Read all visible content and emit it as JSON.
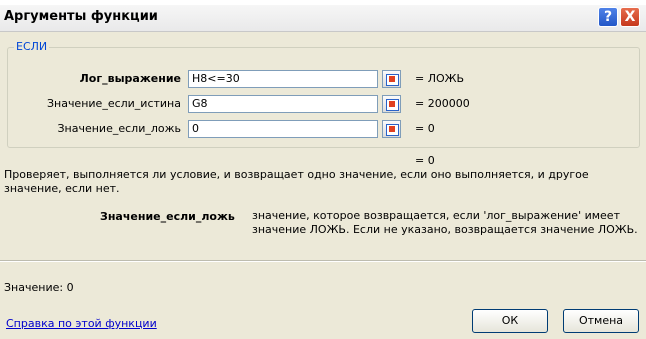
{
  "title": "Аргументы функции",
  "title_buttons": {
    "help": "?",
    "close": "X"
  },
  "function_group": "ЕСЛИ",
  "args": [
    {
      "label": "Лог_выражение",
      "value": "H8<=30",
      "result": "=  ЛОЖЬ"
    },
    {
      "label": "Значение_если_истина",
      "value": "G8",
      "result": "=  200000"
    },
    {
      "label": "Значение_если_ложь",
      "value": "0",
      "result": "=  0"
    }
  ],
  "formula_result": "=  0",
  "description": "Проверяет, выполняется ли условие, и возвращает одно значение, если оно выполняется, и другое значение, если нет.",
  "arg_help": {
    "name": "Значение_если_ложь",
    "text": "значение, которое возвращается, если 'лог_выражение' имеет значение ЛОЖЬ. Если не указано, возвращается значение ЛОЖЬ."
  },
  "value_line": "Значение:  0",
  "help_link": "Справка по этой функции",
  "buttons": {
    "ok": "ОК",
    "cancel": "Отмена"
  },
  "icons": {
    "ref_picker": "range-selector-icon"
  }
}
